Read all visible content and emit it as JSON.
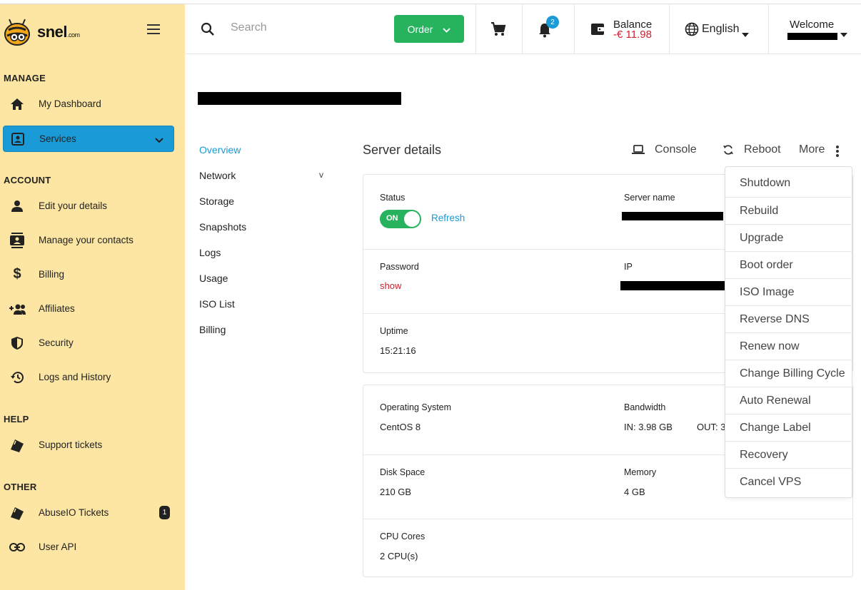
{
  "brand": {
    "name": "snel",
    "suffix": ".com"
  },
  "sidebar": {
    "sections": {
      "manage": "MANAGE",
      "account": "ACCOUNT",
      "help": "HELP",
      "other": "OTHER"
    },
    "items": {
      "dashboard": "My Dashboard",
      "services": "Services",
      "edit_details": "Edit your details",
      "contacts": "Manage your contacts",
      "billing": "Billing",
      "affiliates": "Affiliates",
      "security": "Security",
      "logs": "Logs and History",
      "support": "Support tickets",
      "abuseio": "AbuseIO Tickets",
      "abuseio_count": "1",
      "user_api": "User API"
    }
  },
  "topbar": {
    "search_placeholder": "Search",
    "order_label": "Order",
    "notification_count": "2",
    "balance_label": "Balance",
    "balance_value": "-€ 11.98",
    "language": "English",
    "welcome": "Welcome"
  },
  "subnav": {
    "overview": "Overview",
    "network": "Network",
    "network_toggle": "v",
    "storage": "Storage",
    "snapshots": "Snapshots",
    "logs": "Logs",
    "usage": "Usage",
    "iso_list": "ISO List",
    "billing": "Billing"
  },
  "main": {
    "heading": "Server details",
    "console": "Console",
    "reboot": "Reboot",
    "more": "More",
    "status_label": "Status",
    "toggle_state": "ON",
    "refresh": "Refresh",
    "server_name_label": "Server name",
    "password_label": "Password",
    "password_action": "show",
    "ip_label": "IP",
    "uptime_label": "Uptime",
    "uptime_value": "15:21:16",
    "os_label": "Operating System",
    "os_value": "CentOS 8",
    "bandwidth_label": "Bandwidth",
    "bandwidth_in": "IN: 3.98 GB",
    "bandwidth_out": "OUT: 3",
    "disk_label": "Disk Space",
    "disk_value": "210 GB",
    "memory_label": "Memory",
    "memory_value": "4 GB",
    "cpu_label": "CPU Cores",
    "cpu_value": "2 CPU(s)"
  },
  "more_menu": [
    "Shutdown",
    "Rebuild",
    "Upgrade",
    "Boot order",
    "ISO Image",
    "Reverse DNS",
    "Renew now",
    "Change Billing Cycle",
    "Auto Renewal",
    "Change Label",
    "Recovery",
    "Cancel VPS"
  ],
  "colors": {
    "sidebar_bg": "#fde6a3",
    "accent": "#1a9ad6",
    "order_green": "#27b35e",
    "negative": "#d1202f"
  }
}
